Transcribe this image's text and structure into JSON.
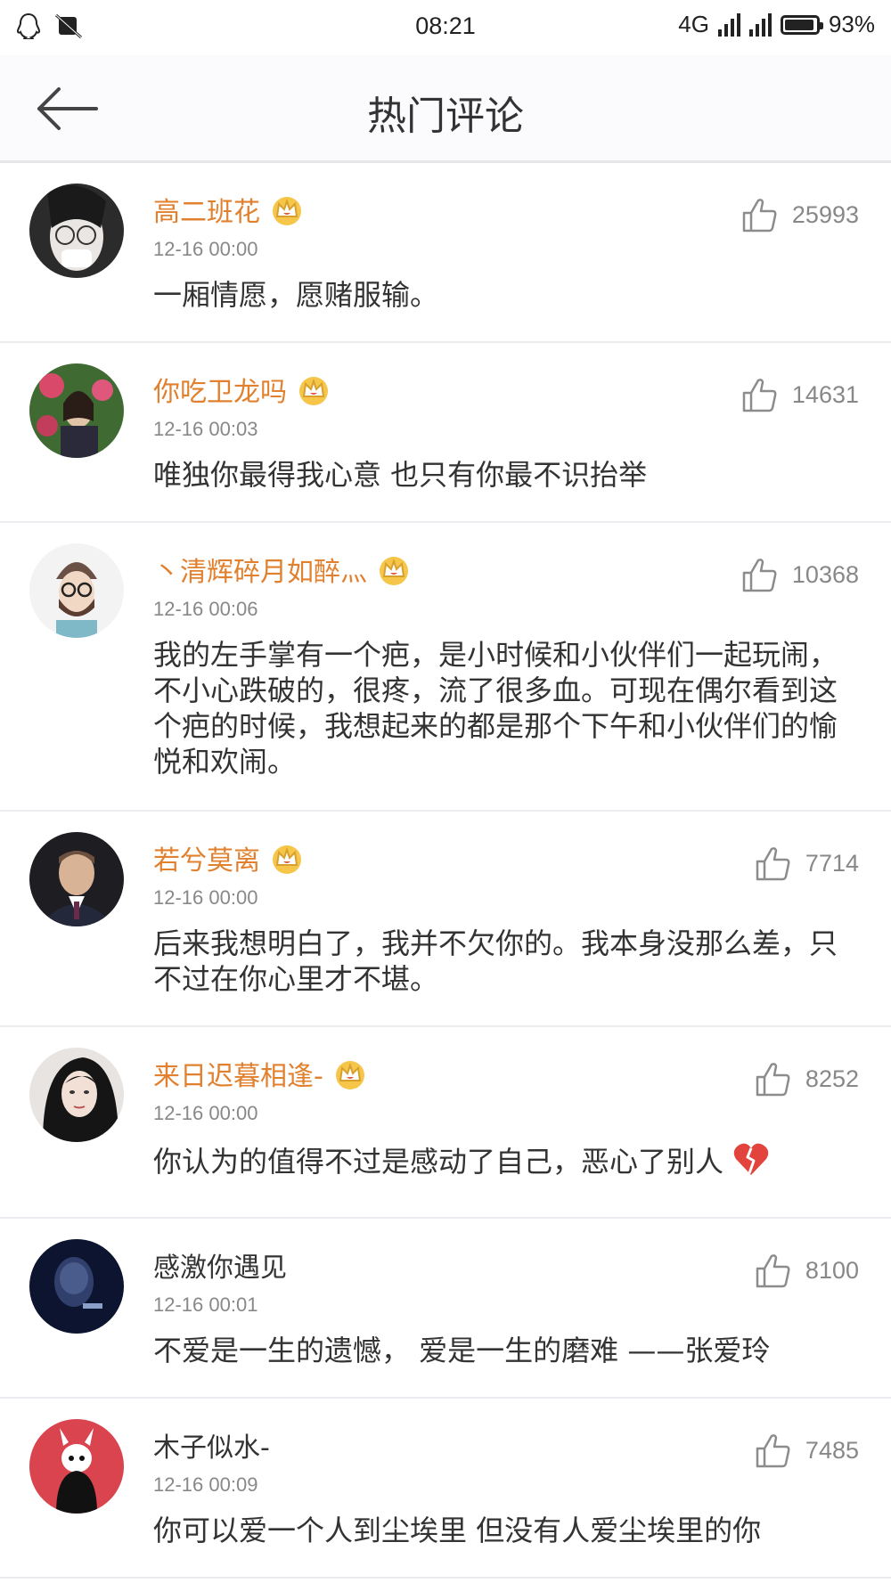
{
  "status": {
    "time": "08:21",
    "network": "4G",
    "battery": "93%",
    "battery_level": 0.93
  },
  "header": {
    "title": "热门评论"
  },
  "comments": [
    {
      "name": "高二班花",
      "vip": true,
      "time": "12-16 00:00",
      "likes": "25993",
      "text": "一厢情愿，愿赌服输。"
    },
    {
      "name": "你吃卫龙吗",
      "vip": true,
      "time": "12-16 00:03",
      "likes": "14631",
      "text": "唯独你最得我心意 也只有你最不识抬举"
    },
    {
      "name": "丶清辉碎月如醉灬",
      "vip": true,
      "time": "12-16 00:06",
      "likes": "10368",
      "text": "我的左手掌有一个疤，是小时候和小伙伴们一起玩闹，不小心跌破的，很疼，流了很多血。可现在偶尔看到这个疤的时候，我想起来的都是那个下午和小伙伴们的愉悦和欢闹。"
    },
    {
      "name": "若兮莫离",
      "vip": true,
      "time": "12-16 00:00",
      "likes": "7714",
      "text": "后来我想明白了，我并不欠你的。我本身没那么差，只不过在你心里才不堪。"
    },
    {
      "name": "来日迟暮相逢-",
      "vip": true,
      "time": "12-16 00:00",
      "likes": "8252",
      "text": "你认为的值得不过是感动了自己，恶心了别人"
    },
    {
      "name": "感激你遇见",
      "vip": false,
      "time": "12-16 00:01",
      "likes": "8100",
      "text": "不爱是一生的遗憾，  爱是一生的磨难 ——张爱玲"
    },
    {
      "name": "木子似水-",
      "vip": false,
      "time": "12-16 00:09",
      "likes": "7485",
      "text": "你可以爱一个人到尘埃里   但没有人爱尘埃里的你"
    }
  ],
  "icons": {
    "back": "arrow-left-icon",
    "like": "thumbs-up-icon",
    "vip": "crown-icon",
    "emoji": "broken-heart-icon"
  },
  "colors": {
    "vip_name": "#e1802e",
    "accent": "#e1802e"
  }
}
